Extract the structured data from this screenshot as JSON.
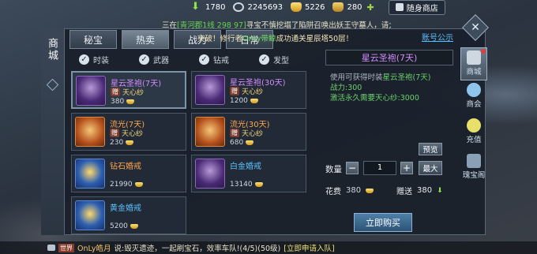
{
  "topbar": {
    "resources": [
      {
        "icon": "arrow-coin-icon",
        "value": "1780"
      },
      {
        "icon": "gear-coin-icon",
        "value": "2245693"
      },
      {
        "icon": "silver-ingot-icon",
        "value": "5226"
      },
      {
        "icon": "gold-bag-icon",
        "value": "280"
      }
    ],
    "shop_label": "随身商店"
  },
  "system_message": {
    "text_prefix": "三在",
    "location": "[青河郡1线 298 97]",
    "text": "寻宝不慎挖塌了陷阱召唤出妖王守墓人，请大家组队"
  },
  "banner": {
    "prefix": "突破！修行者",
    "name": "OnLy带鲸",
    "suffix": "成功通关星辰塔50层！"
  },
  "announcement_link": "账号公示",
  "side_title": "商城",
  "tabs": [
    {
      "label": "秘宝"
    },
    {
      "label": "热卖",
      "active": true
    },
    {
      "label": "战力"
    },
    {
      "label": "日常"
    }
  ],
  "filters": [
    {
      "label": "时装"
    },
    {
      "label": "武器"
    },
    {
      "label": "钻戒"
    },
    {
      "label": "发型"
    }
  ],
  "items": [
    {
      "name": "星云圣袍(7天)",
      "color": "p",
      "sub": "天心纱",
      "price": "380",
      "thumb": "purple",
      "selected": true
    },
    {
      "name": "星云圣袍(30天)",
      "color": "p",
      "sub": "天心纱",
      "price": "1200",
      "thumb": "purple"
    },
    {
      "name": "流光(7天)",
      "color": "o",
      "sub": "天心纱",
      "price": "230",
      "thumb": "orange"
    },
    {
      "name": "流光(30天)",
      "color": "o",
      "sub": "天心纱",
      "price": "680",
      "thumb": "orange"
    },
    {
      "name": "钻石婚戒",
      "color": "o",
      "sub": "",
      "price": "21990",
      "thumb": "blue"
    },
    {
      "name": "白金婚戒",
      "color": "b",
      "sub": "",
      "price": "13140",
      "thumb": "purple"
    },
    {
      "name": "黄金婚戒",
      "color": "b",
      "sub": "",
      "price": "5200",
      "thumb": "blue"
    }
  ],
  "gift_tag": "赠",
  "detail": {
    "title": "星云圣袍(7天)",
    "line1_prefix": "使用可获得时装",
    "line1_item": "星云圣袍(7天)",
    "line2": "战力:300",
    "line3": "激活永久需要天心纱:3000"
  },
  "preview_label": "预览",
  "quantity": {
    "label": "数量",
    "value": "1",
    "minus": "−",
    "plus": "+",
    "max_label": "最大"
  },
  "cost": {
    "label": "花费",
    "value": "380",
    "gift_label": "赠送",
    "gift_value": "380"
  },
  "buy_label": "立即购买",
  "right_nav": [
    {
      "label": "商城",
      "icon": "shop-icon",
      "active": true
    },
    {
      "label": "商会",
      "icon": "trade-icon"
    },
    {
      "label": "充值",
      "icon": "charge-icon"
    },
    {
      "label": "瑰宝阁",
      "icon": "treasure-icon"
    }
  ],
  "bottom_chat": {
    "tag": "世界",
    "name": "OnLy皓月",
    "message": "说:毁灭遗迹，一起刷宝石，效率车队!(4/5)(50级)",
    "link": "[立即申请入队]"
  }
}
